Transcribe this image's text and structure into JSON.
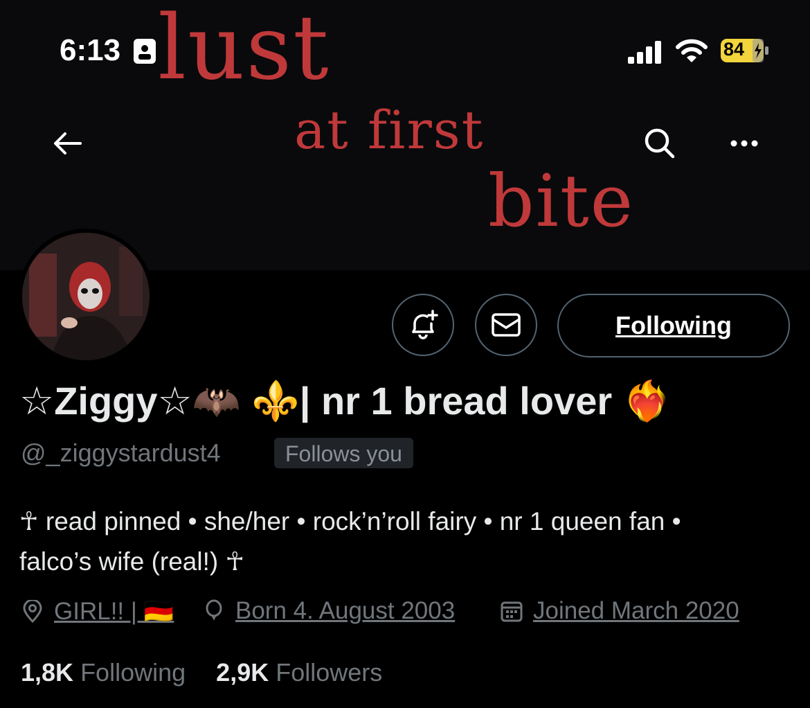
{
  "status_bar": {
    "time": "6:13",
    "battery": "84"
  },
  "banner": {
    "line1": "lust",
    "line2": "at first",
    "line3": "bite"
  },
  "profile": {
    "display_name": "☆Ziggy☆🦇 ⚜️| nr 1 bread lover ❤️‍🔥",
    "handle": "@_ziggystardust4",
    "follows_you": "Follows you",
    "bio_line1": "☥ read pinned • she/her • rock’n’roll fairy • nr 1 queen fan •",
    "bio_line2": "falco’s wife (real!) ☥",
    "location": "GIRL!! | 🇩🇪",
    "birthday": "Born 4. August 2003",
    "joined": "Joined March 2020",
    "following_count": "1,8K",
    "following_label": "Following",
    "followers_count": "2,9K",
    "followers_label": "Followers"
  },
  "actions": {
    "following_button": "Following"
  },
  "colors": {
    "background": "#000000",
    "muted": "#71767b",
    "banner_text": "#c0393a",
    "battery": "#f2d43d"
  }
}
